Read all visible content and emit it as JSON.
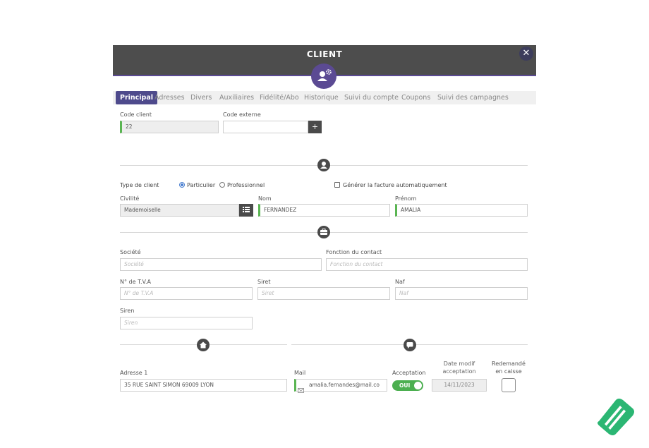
{
  "dialog": {
    "title": "CLIENT",
    "close_label": "✕"
  },
  "tabs": [
    {
      "label": "Principal",
      "active": true
    },
    {
      "label": "Adresses"
    },
    {
      "label": "Divers"
    },
    {
      "label": "Auxiliaires"
    },
    {
      "label": "Fidélité/Abo"
    },
    {
      "label": "Historique"
    },
    {
      "label": "Suivi du compte"
    },
    {
      "label": "Coupons"
    },
    {
      "label": "Suivi des campagnes"
    }
  ],
  "codes": {
    "code_client_label": "Code client",
    "code_client_value": "22",
    "code_externe_label": "Code externe",
    "code_externe_value": "",
    "add_label": "+"
  },
  "identity": {
    "type_label": "Type de client",
    "particulier_label": "Particulier",
    "professionnel_label": "Professionnel",
    "facture_label": "Générer la facture automatiquement",
    "civilite_label": "Civilité",
    "civilite_value": "Mademoiselle",
    "nom_label": "Nom",
    "nom_value": "FERNANDEZ",
    "prenom_label": "Prénom",
    "prenom_value": "AMALIA"
  },
  "company": {
    "societe_label": "Société",
    "societe_placeholder": "Société",
    "fonction_label": "Fonction du contact",
    "fonction_placeholder": "Fonction du contact",
    "tva_label": "N° de T.V.A",
    "tva_placeholder": "N° de T.V.A",
    "siret_label": "Siret",
    "siret_placeholder": "Siret",
    "naf_label": "Naf",
    "naf_placeholder": "Naf",
    "siren_label": "Siren",
    "siren_placeholder": "Siren"
  },
  "address": {
    "adresse_label": "Adresse 1",
    "adresse_value": "35 RUE SAINT SIMON 69009 LYON"
  },
  "contact": {
    "mail_label": "Mail",
    "mail_value": "amalia.fernandes@mail.co",
    "acceptation_label": "Acceptation",
    "acceptation_toggle": "OUI",
    "date_label_1": "Date modif",
    "date_label_2": "acceptation",
    "date_value": "14/11/2023",
    "redemande_label_1": "Redemandé",
    "redemande_label_2": "en caisse"
  },
  "colors": {
    "accent": "#5b4a93",
    "header": "#4d4d4d",
    "green": "#5ab552",
    "toggle": "#4caf50"
  }
}
